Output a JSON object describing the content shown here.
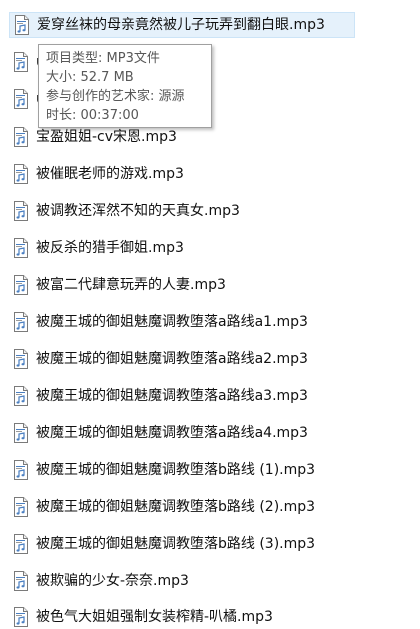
{
  "files": [
    {
      "name": "爱穿丝袜的母亲竟然被儿子玩弄到翻白眼.mp3",
      "selected": true,
      "visible_name": "爱穿丝袜的母亲竟然被儿子玩弄到翻白眼.mp3"
    },
    {
      "name": "",
      "selected": false,
      "visible_name": "ü"
    },
    {
      "name": "",
      "selected": false,
      "visible_name": "ü"
    },
    {
      "name": "宝盈姐姐-cv宋恩.mp3",
      "selected": false,
      "visible_name": "宝盈姐姐-cv宋恩.mp3"
    },
    {
      "name": "被催眠老师的游戏.mp3",
      "selected": false,
      "visible_name": "被催眠老师的游戏.mp3"
    },
    {
      "name": "被调教还浑然不知的天真女.mp3",
      "selected": false,
      "visible_name": "被调教还浑然不知的天真女.mp3"
    },
    {
      "name": "被反杀的猎手御姐.mp3",
      "selected": false,
      "visible_name": "被反杀的猎手御姐.mp3"
    },
    {
      "name": "被富二代肆意玩弄的人妻.mp3",
      "selected": false,
      "visible_name": "被富二代肆意玩弄的人妻.mp3"
    },
    {
      "name": "被魔王城的御姐魅魔调教堕落a路线a1.mp3",
      "selected": false,
      "visible_name": "被魔王城的御姐魅魔调教堕落a路线a1.mp3"
    },
    {
      "name": "被魔王城的御姐魅魔调教堕落a路线a2.mp3",
      "selected": false,
      "visible_name": "被魔王城的御姐魅魔调教堕落a路线a2.mp3"
    },
    {
      "name": "被魔王城的御姐魅魔调教堕落a路线a3.mp3",
      "selected": false,
      "visible_name": "被魔王城的御姐魅魔调教堕落a路线a3.mp3"
    },
    {
      "name": "被魔王城的御姐魅魔调教堕落a路线a4.mp3",
      "selected": false,
      "visible_name": "被魔王城的御姐魅魔调教堕落a路线a4.mp3"
    },
    {
      "name": "被魔王城的御姐魅魔调教堕落b路线 (1).mp3",
      "selected": false,
      "visible_name": "被魔王城的御姐魅魔调教堕落b路线 (1).mp3"
    },
    {
      "name": "被魔王城的御姐魅魔调教堕落b路线 (2).mp3",
      "selected": false,
      "visible_name": "被魔王城的御姐魅魔调教堕落b路线 (2).mp3"
    },
    {
      "name": "被魔王城的御姐魅魔调教堕落b路线 (3).mp3",
      "selected": false,
      "visible_name": "被魔王城的御姐魅魔调教堕落b路线 (3).mp3"
    },
    {
      "name": "被欺骗的少女-奈奈.mp3",
      "selected": false,
      "visible_name": "被欺骗的少女-奈奈.mp3"
    },
    {
      "name": "被色气大姐姐强制女装榨精-叭橘.mp3",
      "selected": false,
      "visible_name": "被色气大姐姐强制女装榨精-叭橘.mp3"
    }
  ],
  "tooltip": {
    "type_line": "项目类型: MP3文件",
    "size_line": "大小: 52.7 MB",
    "artist_line": "参与创作的艺术家: 源源",
    "duration_line": "时长: 00:37:00"
  },
  "colors": {
    "selection_bg": "#e5f1fb",
    "selection_border": "#cce4f7",
    "icon_accent": "#4a7fc1"
  }
}
